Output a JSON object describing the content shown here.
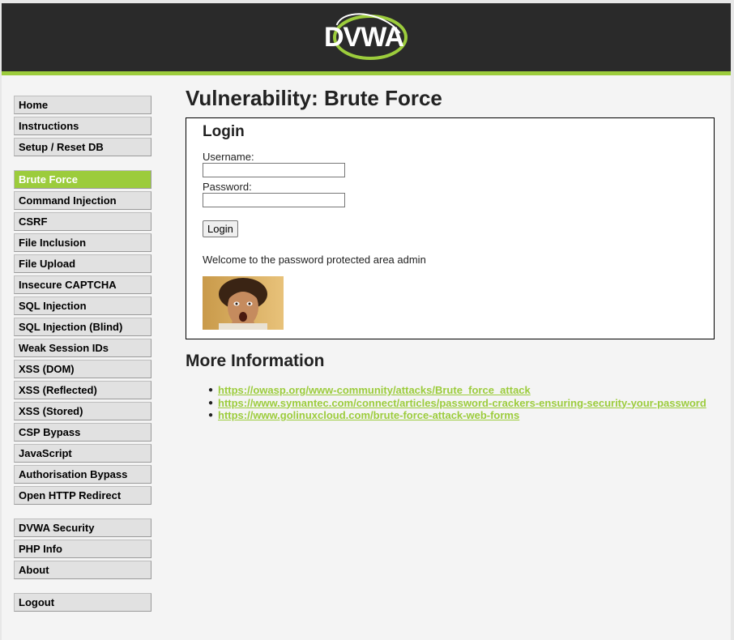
{
  "logo": {
    "text": "DVWA"
  },
  "colors": {
    "accent": "#9ccc3c",
    "header_bg": "#2a2a2a",
    "menu_bg": "#e1e1e1"
  },
  "sidebar": {
    "group1": [
      {
        "label": "Home"
      },
      {
        "label": "Instructions"
      },
      {
        "label": "Setup / Reset DB"
      }
    ],
    "group2": [
      {
        "label": "Brute Force",
        "selected": true
      },
      {
        "label": "Command Injection"
      },
      {
        "label": "CSRF"
      },
      {
        "label": "File Inclusion"
      },
      {
        "label": "File Upload"
      },
      {
        "label": "Insecure CAPTCHA"
      },
      {
        "label": "SQL Injection"
      },
      {
        "label": "SQL Injection (Blind)"
      },
      {
        "label": "Weak Session IDs"
      },
      {
        "label": "XSS (DOM)"
      },
      {
        "label": "XSS (Reflected)"
      },
      {
        "label": "XSS (Stored)"
      },
      {
        "label": "CSP Bypass"
      },
      {
        "label": "JavaScript"
      },
      {
        "label": "Authorisation Bypass"
      },
      {
        "label": "Open HTTP Redirect"
      }
    ],
    "group3": [
      {
        "label": "DVWA Security"
      },
      {
        "label": "PHP Info"
      },
      {
        "label": "About"
      }
    ],
    "group4": [
      {
        "label": "Logout"
      }
    ]
  },
  "main": {
    "title": "Vulnerability: Brute Force",
    "login": {
      "heading": "Login",
      "username_label": "Username:",
      "username_value": "",
      "password_label": "Password:",
      "password_value": "",
      "button_label": "Login",
      "welcome": "Welcome to the password protected area admin"
    },
    "more_info": {
      "heading": "More Information",
      "links": [
        "https://owasp.org/www-community/attacks/Brute_force_attack",
        "https://www.symantec.com/connect/articles/password-crackers-ensuring-security-your-password",
        "https://www.golinuxcloud.com/brute-force-attack-web-forms"
      ]
    }
  }
}
